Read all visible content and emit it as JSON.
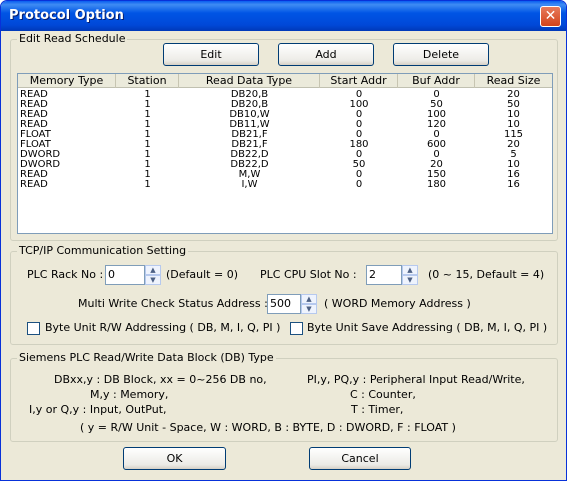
{
  "window": {
    "title": "Protocol Option"
  },
  "schedule": {
    "group_label": "Edit Read Schedule",
    "edit_label": "Edit",
    "add_label": "Add",
    "delete_label": "Delete",
    "columns": [
      "Memory Type",
      "Station",
      "Read Data Type",
      "Start Addr",
      "Buf Addr",
      "Read Size"
    ],
    "rows": [
      [
        "READ",
        "1",
        "DB20,B",
        "0",
        "0",
        "20"
      ],
      [
        "READ",
        "1",
        "DB20,B",
        "100",
        "50",
        "50"
      ],
      [
        "READ",
        "1",
        "DB10,W",
        "0",
        "100",
        "10"
      ],
      [
        "READ",
        "1",
        "DB11,W",
        "0",
        "120",
        "10"
      ],
      [
        "FLOAT",
        "1",
        "DB21,F",
        "0",
        "0",
        "115"
      ],
      [
        "FLOAT",
        "1",
        "DB21,F",
        "180",
        "600",
        "20"
      ],
      [
        "DWORD",
        "1",
        "DB22,D",
        "0",
        "0",
        "5"
      ],
      [
        "DWORD",
        "1",
        "DB22,D",
        "50",
        "20",
        "10"
      ],
      [
        "READ",
        "1",
        "M,W",
        "0",
        "150",
        "16"
      ],
      [
        "READ",
        "1",
        "I,W",
        "0",
        "180",
        "16"
      ]
    ]
  },
  "tcp": {
    "group_label": "TCP/IP Communication Setting",
    "rack_label": "PLC Rack No :",
    "rack_value": "0",
    "rack_hint": "(Default = 0)",
    "slot_label": "PLC CPU Slot No :",
    "slot_value": "2",
    "slot_hint": "(0 ~ 15, Default = 4)",
    "multi_label": "Multi Write Check Status Address :",
    "multi_value": "500",
    "multi_hint": "( WORD Memory Address )",
    "byte_rw_label": "Byte Unit R/W Addressing ( DB, M, I, Q, PI )",
    "byte_save_label": "Byte Unit Save Addressing ( DB, M, I, Q, PI )",
    "byte_rw_checked": false,
    "byte_save_checked": false
  },
  "siemens": {
    "group_label": "Siemens PLC Read/Write Data Block (DB) Type",
    "left_lines": [
      "DBxx,y : DB Block,  xx = 0~256 DB no,",
      "M,y : Memory,",
      "I,y or Q,y : Input, OutPut,"
    ],
    "right_lines": [
      "PI,y, PQ,y : Peripheral Input Read/Write,",
      "C : Counter,",
      "T : Timer,"
    ],
    "footer": "( y = R/W Unit - Space, W : WORD, B : BYTE, D : DWORD, F : FLOAT )"
  },
  "footer": {
    "ok_label": "OK",
    "cancel_label": "Cancel"
  },
  "colors": {
    "titlebar": "#0055E5",
    "dialog_bg": "#ECE9D8",
    "close_button": "#D3431C"
  }
}
